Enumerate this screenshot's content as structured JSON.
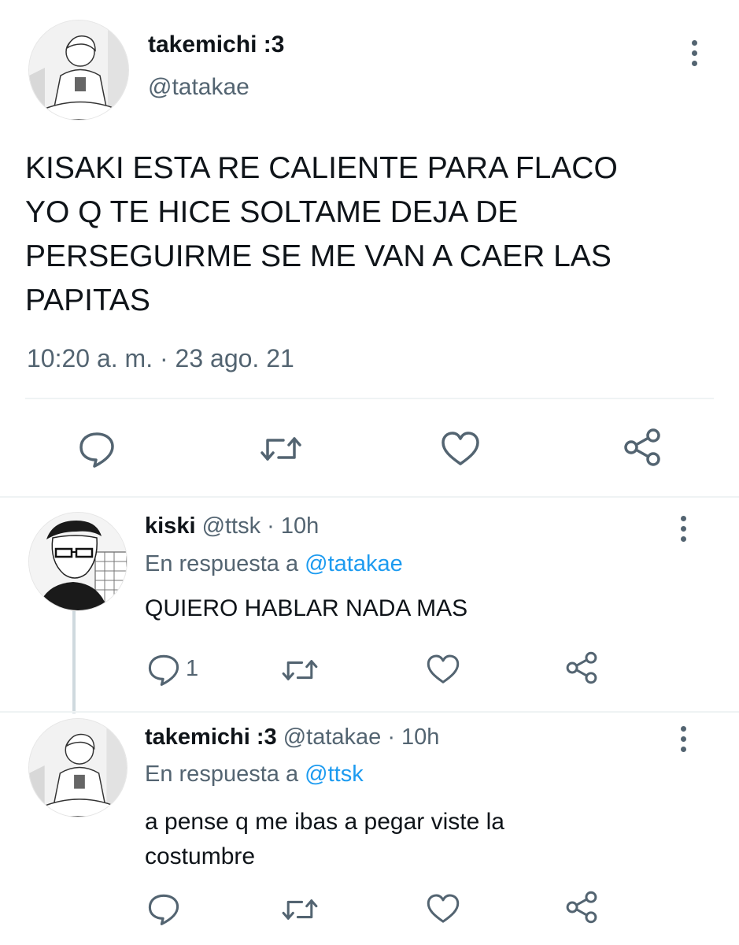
{
  "main_tweet": {
    "display_name": "takemichi :3",
    "handle": "@tatakae",
    "text_lines": [
      "KISAKI ESTA RE CALIENTE PARA FLACO",
      "YO Q TE HICE SOLTAME DEJA DE",
      "PERSEGUIRME SE ME VAN A CAER LAS",
      "PAPITAS"
    ],
    "timestamp": "10:20 a. m. · 23 ago. 21",
    "icons": [
      "more-icon",
      "reply-icon",
      "retweet-icon",
      "like-icon",
      "share-icon"
    ]
  },
  "replies": [
    {
      "display_name": "kiski",
      "handle_time": "@ttsk · 10h",
      "in_reply_prefix": "En respuesta a",
      "in_reply_to": "@tatakae",
      "text": "QUIERO HABLAR NADA MAS",
      "reply_count": "1"
    },
    {
      "display_name": "takemichi :3",
      "handle_time": "@tatakae · 10h",
      "in_reply_prefix": "En respuesta a",
      "in_reply_to": "@ttsk",
      "text_lines": [
        "a pense q me ibas a pegar viste la",
        "costumbre"
      ],
      "reply_count": ""
    }
  ],
  "colors": {
    "text": "#0f1419",
    "secondary": "#536471",
    "link": "#1d9bf0",
    "divider": "#eff3f4"
  }
}
